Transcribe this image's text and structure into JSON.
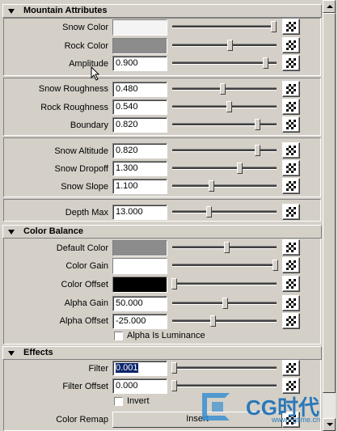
{
  "sections": {
    "mountain": {
      "title": "Mountain Attributes"
    },
    "colorBalance": {
      "title": "Color Balance"
    },
    "effects": {
      "title": "Effects"
    }
  },
  "rows": {
    "snowColor": {
      "label": "Snow Color",
      "color": "#f4f4f4",
      "slider": 0.98
    },
    "rockColor": {
      "label": "Rock Color",
      "color": "#8c8c8c",
      "slider": 0.55
    },
    "amplitude": {
      "label": "Amplitude",
      "value": "0.900",
      "slider": 0.9
    },
    "snowRoughness": {
      "label": "Snow Roughness",
      "value": "0.480",
      "slider": 0.48
    },
    "rockRoughness": {
      "label": "Rock Roughness",
      "value": "0.540",
      "slider": 0.54
    },
    "boundary": {
      "label": "Boundary",
      "value": "0.820",
      "slider": 0.82
    },
    "snowAltitude": {
      "label": "Snow Altitude",
      "value": "0.820",
      "slider": 0.82
    },
    "snowDropoff": {
      "label": "Snow Dropoff",
      "value": "1.300",
      "slider": 0.65
    },
    "snowSlope": {
      "label": "Snow Slope",
      "value": "1.100",
      "slider": 0.37
    },
    "depthMax": {
      "label": "Depth Max",
      "value": "13.000",
      "slider": 0.34
    },
    "defaultColor": {
      "label": "Default Color",
      "color": "#8c8c8c",
      "slider": 0.52
    },
    "colorGain": {
      "label": "Color Gain",
      "color": "#ffffff",
      "slider": 1.0
    },
    "colorOffset": {
      "label": "Color Offset",
      "color": "#000000",
      "slider": 0.0
    },
    "alphaGain": {
      "label": "Alpha Gain",
      "value": "50.000",
      "slider": 0.5
    },
    "alphaOffset": {
      "label": "Alpha Offset",
      "value": "-25.000",
      "slider": 0.38
    },
    "alphaIsLuminance": {
      "label": "Alpha Is Luminance"
    },
    "filter": {
      "label": "Filter",
      "value": "0.001",
      "slider": 0.0
    },
    "filterOffset": {
      "label": "Filter Offset",
      "value": "0.000",
      "slider": 0.0
    },
    "invert": {
      "label": "Invert"
    },
    "colorRemap": {
      "label": "Color Remap",
      "button": "Insert"
    }
  },
  "watermark": {
    "text": "CG时代",
    "url": "www.cgtime.cn"
  }
}
